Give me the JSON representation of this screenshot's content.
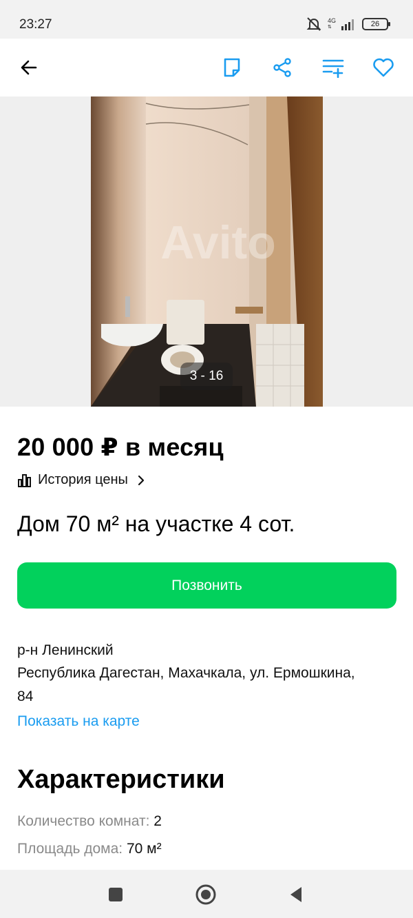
{
  "status_bar": {
    "time": "23:27",
    "network": "4G",
    "battery": "26"
  },
  "app_bar": {
    "icons": [
      "back-arrow-icon",
      "note-icon",
      "share-icon",
      "compare-list-icon",
      "favorite-heart-icon"
    ],
    "accent_color": "#1a9cf0"
  },
  "gallery": {
    "counter": "3 - 16",
    "watermark": "Avito"
  },
  "listing": {
    "price": "20 000 ₽ в месяц",
    "price_history_label": "История цены",
    "title": "Дом 70 м² на участке 4 сот.",
    "call_button": "Позвонить",
    "call_button_color": "#02d15c"
  },
  "address": {
    "district": "р-н Ленинский",
    "line1": "Республика Дагестан, Махачкала, ул. Ермошкина,",
    "line2": "84",
    "map_link": "Показать на карте"
  },
  "characteristics": {
    "title": "Характеристики",
    "rows": [
      {
        "label": "Количество комнат:",
        "value": "2"
      },
      {
        "label": "Площадь дома:",
        "value": "70 м²"
      }
    ]
  },
  "nav_bar": {
    "icons": [
      "recents-square-icon",
      "home-circle-icon",
      "back-triangle-icon"
    ]
  }
}
